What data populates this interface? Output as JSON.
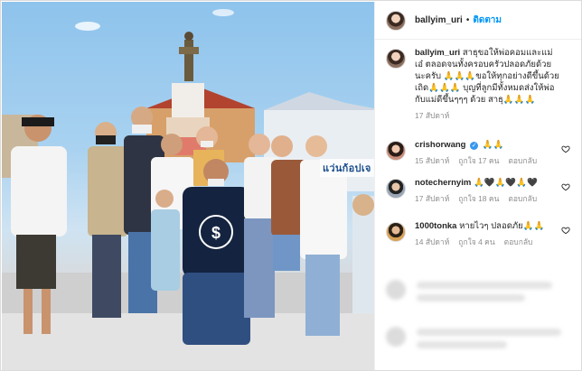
{
  "post": {
    "username": "ballyim_uri",
    "separator": "•",
    "follow_label": "ติดตาม"
  },
  "photo": {
    "sign_text": "แว่นก้อปเจ"
  },
  "caption": {
    "username": "ballyim_uri",
    "text": "สาธุขอให้พ่อคอมและแม่เอ๋ ตลอดจนทั้งครอบครัวปลอดภัยด้วยนะครับ 🙏🙏🙏ขอให้ทุกอย่างดีขึ้นด้วยเถิด🙏🙏🙏 บุญที่ลูกมีทั้งหมดส่งให้พ่อกับแม่ดีขึ้นๆๆๆ ด้วย สาธุ🙏🙏🙏",
    "time": "17 สัปดาห์"
  },
  "comments": [
    {
      "username": "crishorwang",
      "verified": true,
      "text": "🙏🙏",
      "time": "15 สัปดาห์",
      "likes": "ถูกใจ 17 คน",
      "reply": "ตอบกลับ"
    },
    {
      "username": "notechernyim",
      "verified": false,
      "text": "🙏🖤🙏🖤🙏🖤",
      "time": "17 สัปดาห์",
      "likes": "ถูกใจ 18 คน",
      "reply": "ตอบกลับ"
    },
    {
      "username": "1000tonka",
      "verified": false,
      "text": "หายไวๆ ปลอดภัย🙏🙏",
      "time": "14 สัปดาห์",
      "likes": "ถูกใจ 4 คน",
      "reply": "ตอบกลับ"
    }
  ],
  "colors": {
    "accent": "#0095f6",
    "muted": "#8e8e8e",
    "text": "#262626"
  }
}
